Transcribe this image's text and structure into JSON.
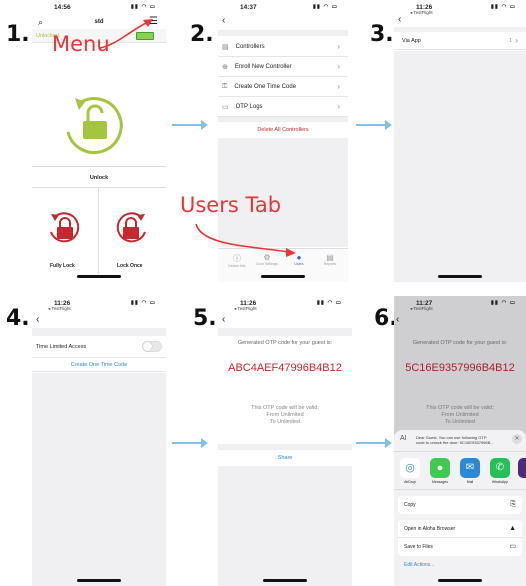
{
  "steps": [
    "1.",
    "2.",
    "3.",
    "4.",
    "5.",
    "6."
  ],
  "annotations": {
    "menu": "Menu",
    "users_tab": "Users Tab"
  },
  "colors": {
    "arrow": "#7cc3e6",
    "accent_red": "#c8282d",
    "lock_green": "#a3c63c",
    "link_blue": "#2a8ad6"
  },
  "s1": {
    "time": "14:56",
    "title": "std",
    "status": "Unlocked",
    "battery_icon": "battery-icon",
    "unlock": "Unlock",
    "fully_lock": "Fully Lock",
    "lock_once": "Lock Once"
  },
  "s2": {
    "time": "14:37",
    "items": [
      "Controllers",
      "Enroll New Controller",
      "Create One Time Code",
      "OTP Logs"
    ],
    "delete": "Delete All Controllers",
    "tabs": [
      "Device Info",
      "Door Settings",
      "Users",
      "Reports"
    ]
  },
  "s3": {
    "time": "11:26",
    "testflight": "◂ TestFlight",
    "row": "Via App",
    "row_value": "1"
  },
  "s4": {
    "time": "11:26",
    "testflight": "◂ TestFlight",
    "toggle": "Time Limited Access",
    "create": "Create One Time Code"
  },
  "s5": {
    "time": "11:26",
    "testflight": "◂ TestFlight",
    "hdr": "Generated OTP code for your guest is:",
    "code": "ABC4AEF47996B4B12",
    "valid1": "This OTP code will be valid;",
    "valid2": "From Unlimited",
    "valid3": "To Unlimited",
    "share": "Share"
  },
  "s6": {
    "time": "11:27",
    "testflight": "◂ TestFlight",
    "hdr": "Generated OTP code for your guest is:",
    "code": "5C16E9357996B4B12",
    "valid1": "This OTP code will be valid;",
    "valid2": "From Unlimited",
    "valid3": "To Unlimited",
    "msg_initials": "AI",
    "msg1": "Dear Guest,  You can use following OTP",
    "msg2": "code to unlock the door: 5C16E9357996B...",
    "apps": [
      "AirDrop",
      "Messages",
      "Mail",
      "WhatsApp"
    ],
    "actions": [
      "Copy",
      "Open in Aloha Browser",
      "Save to Files",
      "Edit Actions..."
    ]
  }
}
